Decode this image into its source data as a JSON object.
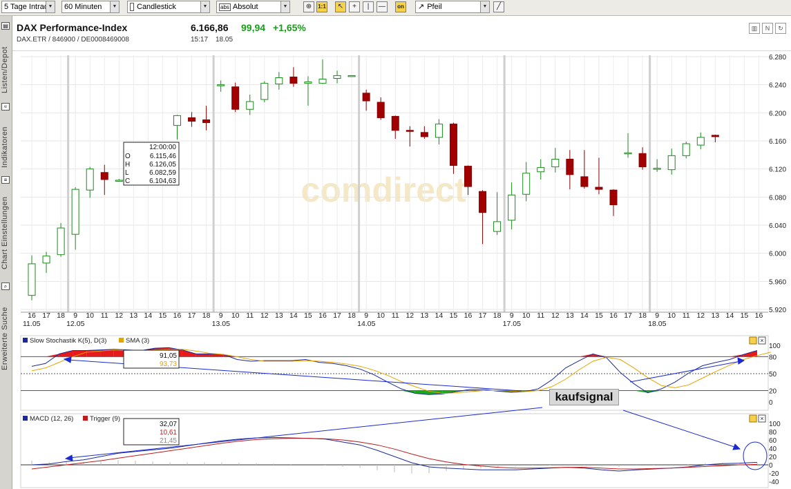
{
  "toolbar": {
    "range": "5 Tage Intrad",
    "interval": "60 Minuten",
    "chart_type": "Candlestick",
    "scale": "Absolut",
    "zoom_label": "1:1",
    "on_label": "on",
    "draw_tool": "Pfeil"
  },
  "sidebar": {
    "tabs": [
      "Listen/Depot",
      "Indikatoren",
      "Chart Einstellungen",
      "Erweiterte Suche"
    ]
  },
  "header": {
    "title": "DAX Performance-Index",
    "subtitle": "DAX.ETR  /  846900  /  DE0008469008",
    "price": "6.166,86",
    "change_abs": "99,94",
    "change_pct": "+1,65%",
    "time": "15:17",
    "date": "18.05",
    "up_color": "#1a9c1a"
  },
  "watermark": "comdirect",
  "tooltip_main": {
    "time": "12:00:00",
    "rows": [
      [
        "O",
        "6.115,46"
      ],
      [
        "H",
        "6.126,05"
      ],
      [
        "L",
        "6.082,59"
      ],
      [
        "C",
        "6.104,63"
      ]
    ]
  },
  "stoch_legend": {
    "k": "Slow Stochastik K(5), D(3)",
    "sma": "SMA (3)"
  },
  "stoch_tooltip": {
    "v1": "91,05",
    "v2": "93,73"
  },
  "macd_legend": {
    "macd": "MACD (12, 26)",
    "trigger": "Trigger (9)"
  },
  "macd_tooltip": {
    "v1": "32,07",
    "v2": "10,61",
    "v3": "21,45"
  },
  "annotation": "kaufsignal",
  "chart_data": [
    {
      "type": "candlestick",
      "title": "DAX Performance-Index",
      "interval": "60 Minuten",
      "ylim": [
        5920,
        6280
      ],
      "yticks": [
        "5.920",
        "5.960",
        "6.000",
        "6.040",
        "6.080",
        "6.120",
        "6.160",
        "6.200",
        "6.240",
        "6.280"
      ],
      "grid": true,
      "day_labels": [
        {
          "label": "11.05",
          "start": 0
        },
        {
          "label": "12.05",
          "start": 3
        },
        {
          "label": "13.05",
          "start": 13
        },
        {
          "label": "14.05",
          "start": 23
        },
        {
          "label": "17.05",
          "start": 33
        },
        {
          "label": "18.05",
          "start": 43
        }
      ],
      "hours": [
        16,
        17,
        18,
        9,
        10,
        11,
        12,
        13,
        14,
        15,
        16,
        17,
        18,
        9,
        10,
        11,
        12,
        13,
        14,
        15,
        16,
        17,
        18,
        9,
        10,
        11,
        12,
        13,
        14,
        15,
        16,
        17,
        18,
        9,
        10,
        11,
        12,
        13,
        14,
        15,
        16,
        17,
        18,
        9,
        10,
        11,
        12,
        13,
        14,
        15,
        16
      ],
      "candles": [
        {
          "o": 5940,
          "h": 5997,
          "l": 5933,
          "c": 5985
        },
        {
          "o": 5986,
          "h": 6002,
          "l": 5972,
          "c": 5996
        },
        {
          "o": 5998,
          "h": 6043,
          "l": 5995,
          "c": 6036
        },
        {
          "o": 6027,
          "h": 6094,
          "l": 6005,
          "c": 6091
        },
        {
          "o": 6090,
          "h": 6123,
          "l": 6079,
          "c": 6120
        },
        {
          "o": 6115,
          "h": 6126,
          "l": 6083,
          "c": 6105
        },
        {
          "o": 6103,
          "h": 6106,
          "l": 6103,
          "c": 6104
        },
        {
          "o": 6104,
          "h": 6104,
          "l": 6104,
          "c": 6104
        },
        {
          "o": 6104,
          "h": 6104,
          "l": 6104,
          "c": 6104
        },
        {
          "o": 6105,
          "h": 6105,
          "l": 6105,
          "c": 6105
        },
        {
          "o": 6182,
          "h": 6197,
          "l": 6162,
          "c": 6196
        },
        {
          "o": 6193,
          "h": 6201,
          "l": 6180,
          "c": 6188
        },
        {
          "o": 6190,
          "h": 6210,
          "l": 6175,
          "c": 6186
        },
        {
          "o": 6240,
          "h": 6246,
          "l": 6230,
          "c": 6240
        },
        {
          "o": 6237,
          "h": 6243,
          "l": 6201,
          "c": 6205
        },
        {
          "o": 6205,
          "h": 6226,
          "l": 6197,
          "c": 6216
        },
        {
          "o": 6219,
          "h": 6245,
          "l": 6215,
          "c": 6242
        },
        {
          "o": 6241,
          "h": 6258,
          "l": 6233,
          "c": 6250
        },
        {
          "o": 6251,
          "h": 6265,
          "l": 6237,
          "c": 6242
        },
        {
          "o": 6242,
          "h": 6252,
          "l": 6210,
          "c": 6244
        },
        {
          "o": 6242,
          "h": 6276,
          "l": 6241,
          "c": 6248
        },
        {
          "o": 6249,
          "h": 6260,
          "l": 6242,
          "c": 6253
        },
        {
          "o": 6253,
          "h": 6253,
          "l": 6253,
          "c": 6253
        },
        {
          "o": 6228,
          "h": 6233,
          "l": 6203,
          "c": 6217
        },
        {
          "o": 6215,
          "h": 6222,
          "l": 6190,
          "c": 6193
        },
        {
          "o": 6195,
          "h": 6196,
          "l": 6163,
          "c": 6175
        },
        {
          "o": 6175,
          "h": 6181,
          "l": 6152,
          "c": 6174
        },
        {
          "o": 6172,
          "h": 6181,
          "l": 6163,
          "c": 6166
        },
        {
          "o": 6165,
          "h": 6191,
          "l": 6155,
          "c": 6184
        },
        {
          "o": 6184,
          "h": 6186,
          "l": 6113,
          "c": 6125
        },
        {
          "o": 6124,
          "h": 6125,
          "l": 6083,
          "c": 6095
        },
        {
          "o": 6088,
          "h": 6090,
          "l": 6013,
          "c": 6058
        },
        {
          "o": 6031,
          "h": 6087,
          "l": 6026,
          "c": 6045
        },
        {
          "o": 6047,
          "h": 6101,
          "l": 6034,
          "c": 6083
        },
        {
          "o": 6084,
          "h": 6130,
          "l": 6074,
          "c": 6114
        },
        {
          "o": 6116,
          "h": 6134,
          "l": 6105,
          "c": 6122
        },
        {
          "o": 6123,
          "h": 6150,
          "l": 6115,
          "c": 6134
        },
        {
          "o": 6134,
          "h": 6147,
          "l": 6091,
          "c": 6112
        },
        {
          "o": 6109,
          "h": 6147,
          "l": 6092,
          "c": 6095
        },
        {
          "o": 6094,
          "h": 6136,
          "l": 6084,
          "c": 6091
        },
        {
          "o": 6090,
          "h": 6091,
          "l": 6053,
          "c": 6069
        },
        {
          "o": 6143,
          "h": 6171,
          "l": 6136,
          "c": 6143
        },
        {
          "o": 6142,
          "h": 6151,
          "l": 6119,
          "c": 6123
        },
        {
          "o": 6121,
          "h": 6134,
          "l": 6116,
          "c": 6121
        },
        {
          "o": 6119,
          "h": 6149,
          "l": 6112,
          "c": 6139
        },
        {
          "o": 6139,
          "h": 6159,
          "l": 6135,
          "c": 6156
        },
        {
          "o": 6154,
          "h": 6172,
          "l": 6148,
          "c": 6165
        },
        {
          "o": 6168,
          "h": 6169,
          "l": 6158,
          "c": 6166
        }
      ]
    },
    {
      "type": "line",
      "title": "Slow Stochastik K(5), D(3)",
      "ylim": [
        -10,
        105
      ],
      "yticks": [
        "100",
        "80",
        "50",
        "20",
        "0"
      ],
      "series": [
        {
          "name": "Slow Stochastik K(5), D(3)",
          "color": "#1a2a9a",
          "values": [
            63,
            68,
            85,
            91,
            91,
            92,
            93,
            92,
            91,
            95,
            96,
            92,
            85,
            85,
            84,
            75,
            72,
            73,
            73,
            73,
            75,
            70,
            68,
            64,
            58,
            48,
            35,
            23,
            15,
            13,
            14,
            18,
            22,
            22,
            19,
            17,
            18,
            23,
            39,
            60,
            73,
            85,
            78,
            52,
            32,
            16,
            23,
            35,
            51,
            64,
            70,
            75,
            84,
            91
          ]
        },
        {
          "name": "SMA (3)",
          "color": "#e8a300",
          "values": [
            55,
            60,
            70,
            80,
            88,
            90,
            92,
            91,
            90,
            92,
            93,
            93,
            90,
            86,
            84,
            80,
            75,
            72,
            72,
            72,
            73,
            72,
            70,
            67,
            63,
            56,
            47,
            36,
            27,
            19,
            15,
            16,
            18,
            20,
            20,
            19,
            18,
            20,
            27,
            40,
            57,
            72,
            79,
            75,
            60,
            43,
            29,
            25,
            30,
            42,
            54,
            65,
            75,
            82,
            88
          ]
        }
      ]
    },
    {
      "type": "line",
      "title": "MACD (12, 26)",
      "ylim": [
        -45,
        105
      ],
      "yticks": [
        "100",
        "80",
        "60",
        "40",
        "20",
        "0",
        "-20",
        "-40"
      ],
      "series": [
        {
          "name": "MACD (12, 26)",
          "color": "#1a2a9a",
          "values": [
            0,
            2,
            8,
            12,
            20,
            28,
            32,
            36,
            40,
            46,
            52,
            58,
            62,
            65,
            66,
            65,
            64,
            62,
            55,
            48,
            35,
            20,
            5,
            -5,
            -8,
            -10,
            -12,
            -12,
            -12,
            -10,
            -8,
            -6,
            -8,
            -12,
            -15,
            -12,
            -10,
            -8,
            -5,
            0,
            3,
            4,
            6
          ]
        },
        {
          "name": "Trigger (9)",
          "color": "#c01a1a",
          "values": [
            -10,
            -5,
            0,
            5,
            10,
            16,
            22,
            28,
            34,
            40,
            46,
            52,
            57,
            61,
            63,
            64,
            64,
            63,
            60,
            55,
            48,
            38,
            26,
            15,
            7,
            1,
            -3,
            -6,
            -8,
            -8,
            -7,
            -6,
            -6,
            -8,
            -10,
            -10,
            -9,
            -8,
            -6,
            -4,
            -2,
            0,
            1
          ]
        }
      ]
    }
  ]
}
